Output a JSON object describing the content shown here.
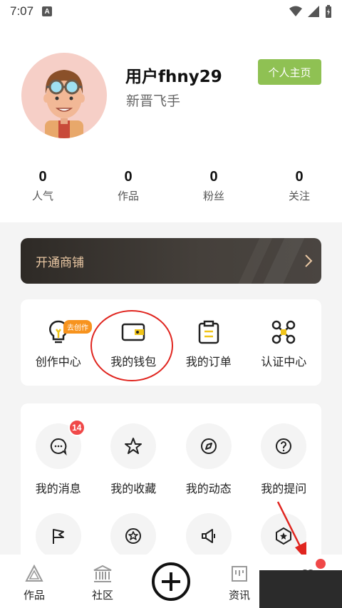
{
  "status_bar": {
    "time": "7:07",
    "a_label": "A"
  },
  "profile": {
    "username": "用户fhny29",
    "level": "新晋飞手",
    "homepage_button": "个人主页"
  },
  "stats": [
    {
      "num": "0",
      "label": "人气"
    },
    {
      "num": "0",
      "label": "作品"
    },
    {
      "num": "0",
      "label": "粉丝"
    },
    {
      "num": "0",
      "label": "关注"
    }
  ],
  "shop_banner": {
    "label": "开通商铺"
  },
  "tools": [
    {
      "label": "创作中心",
      "icon": "lightbulb-icon",
      "badge": "去创作"
    },
    {
      "label": "我的钱包",
      "icon": "wallet-icon"
    },
    {
      "label": "我的订单",
      "icon": "order-list-icon"
    },
    {
      "label": "认证中心",
      "icon": "drone-icon"
    }
  ],
  "menu": [
    {
      "label": "我的消息",
      "icon": "message-icon",
      "badge": "14"
    },
    {
      "label": "我的收藏",
      "icon": "star-icon"
    },
    {
      "label": "我的动态",
      "icon": "compass-icon"
    },
    {
      "label": "我的提问",
      "icon": "question-icon"
    }
  ],
  "menu_row2_icons": [
    "flag-icon",
    "star-badge-icon",
    "megaphone-icon",
    "hexagon-star-icon"
  ],
  "tabbar": [
    {
      "label": "作品",
      "icon": "triangle-icon"
    },
    {
      "label": "社区",
      "icon": "building-icon"
    },
    {
      "label": "",
      "icon": "plus-icon"
    },
    {
      "label": "资讯",
      "icon": "news-icon"
    },
    {
      "label": "",
      "icon": "profile-icon"
    }
  ],
  "colors": {
    "accent_green": "#8fc153",
    "badge_red": "#f04848",
    "badge_orange": "#f7931e",
    "annotation_red": "#e0251f"
  }
}
